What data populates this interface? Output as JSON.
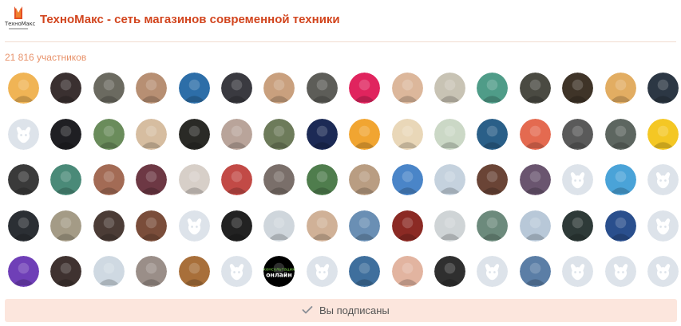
{
  "header": {
    "logo_text": "ТехноМакс",
    "title": "ТехноМакс - сеть магазинов современной техники"
  },
  "members": {
    "count_text": "21 816 участников",
    "rows": [
      [
        "#f0b455",
        "#3a3030",
        "#6b6a60",
        "#b78f73",
        "#2d6ea8",
        "#3a3a40",
        "#c9a07e",
        "#5d5d58",
        "#e0245e",
        "#dcb79b",
        "#c8c3b4",
        "#4f9c88",
        "#4a4a42",
        "#3f3428",
        "#e2ad62",
        "#2c3744"
      ],
      [
        "default",
        "#1f1f23",
        "#6a8c5b",
        "#d6bda0",
        "#2a2a26",
        "#b9a49a",
        "#6d7b5a",
        "#1c2a55",
        "#f1a531",
        "#e9d7b8",
        "#cbd8c6",
        "#2a5f88",
        "#e46a50",
        "#5a5a5a",
        "#5d6660",
        "#f4c724"
      ],
      [
        "#3a3a3a",
        "#4a8a78",
        "#a36b55",
        "#6d3844",
        "#d7cfc8",
        "#c24a46",
        "#7a6f6a",
        "#4f7d4d",
        "#b99d82",
        "#4a85c8",
        "#c5d2de",
        "#6a4436",
        "#6a556f",
        "default",
        "#4aa3d8",
        "default"
      ],
      [
        "#2b2f34",
        "#a49b86",
        "#4b3c36",
        "#7a4d3a",
        "default",
        "#222222",
        "#cfd6dc",
        "#d0b197",
        "#6a8fb4",
        "#8b2a24",
        "#cfd4d6",
        "#6c8a7c",
        "#b8c8d8",
        "#2e3a38",
        "#2a4f8d",
        "default"
      ],
      [
        "#6f3fb7",
        "#3f3230",
        "#cfd9e2",
        "#9a8e88",
        "#a86f3a",
        "default",
        "#000000",
        "default",
        "#3f6f9d",
        "#e2b4a0",
        "#2f2f2f",
        "default",
        "#5b7ea6",
        "default",
        "default",
        "default"
      ]
    ],
    "text_avatars": {
      "r4c6": "консультация онлайн"
    }
  },
  "subscribe": {
    "label": "Вы подписаны"
  },
  "colors": {
    "brand": "#d2451e",
    "count": "#e8926a",
    "subscribe_bg": "#fce6dd",
    "default_avatar_bg": "#dde3ea"
  },
  "icons": {
    "logo": "technomax-logo-icon",
    "check": "check-icon",
    "default_avatar": "vk-dog-avatar-icon"
  }
}
